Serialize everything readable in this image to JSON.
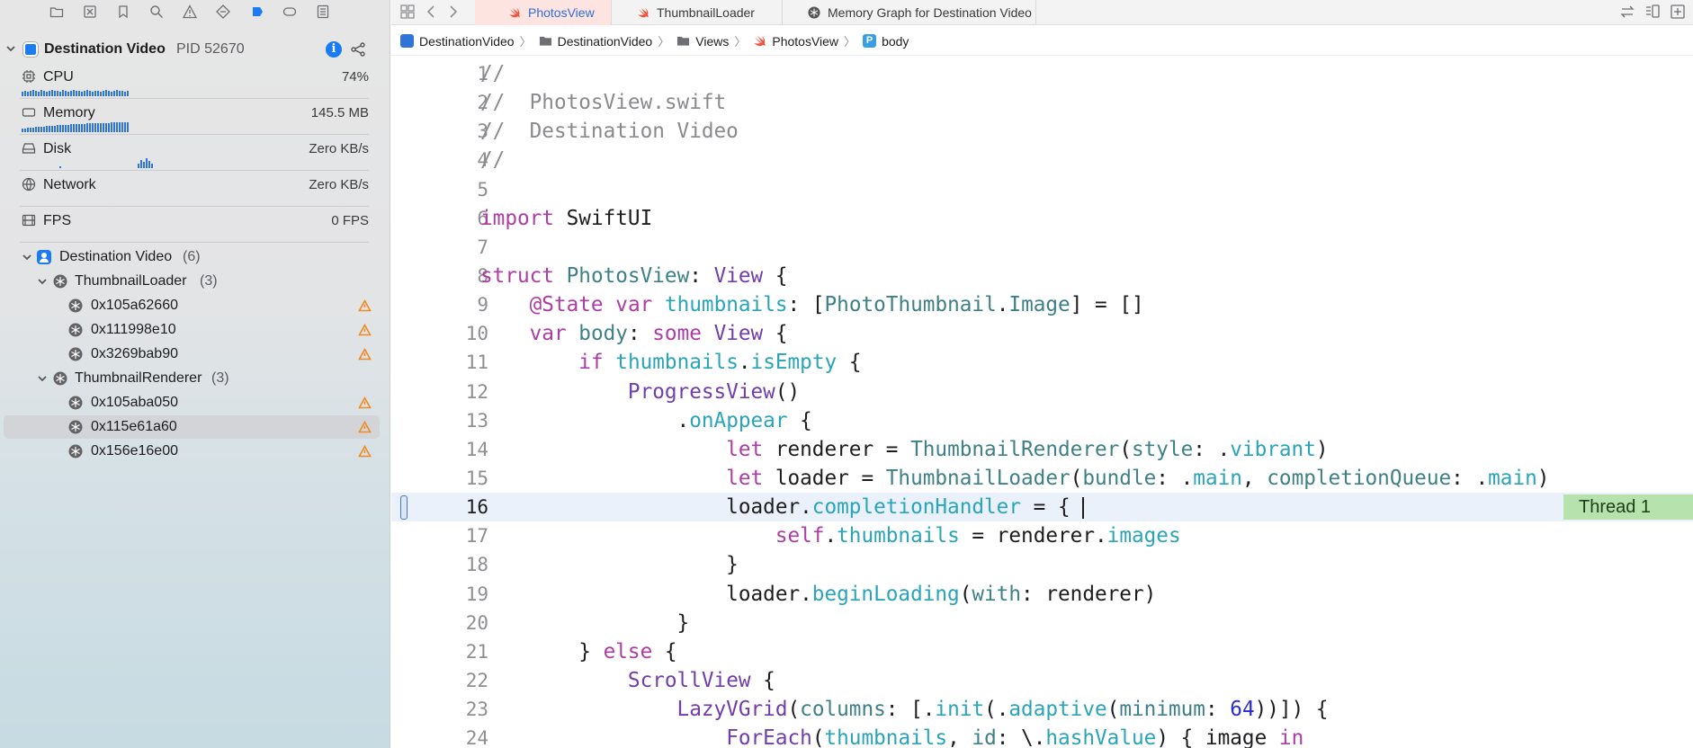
{
  "sidebar": {
    "toolbar_icons": [
      "folder-icon",
      "xmark-square-icon",
      "bookmark-icon",
      "search-icon",
      "warning-icon",
      "diamond-icon",
      "debug-icon",
      "tag-icon",
      "list-icon"
    ],
    "process": {
      "name": "Destination Video",
      "pid": "PID 52670"
    },
    "gauges": [
      {
        "label": "CPU",
        "value": "74%",
        "icon": "cpu-icon"
      },
      {
        "label": "Memory",
        "value": "145.5 MB",
        "icon": "memory-icon"
      },
      {
        "label": "Disk",
        "value": "Zero KB/s",
        "icon": "disk-icon"
      },
      {
        "label": "Network",
        "value": "Zero KB/s",
        "icon": "network-icon"
      },
      {
        "label": "FPS",
        "value": "0 FPS",
        "icon": "fps-icon"
      }
    ],
    "tree": {
      "root": {
        "label": "Destination Video",
        "count": "(6)"
      },
      "groups": [
        {
          "label": "ThumbnailLoader",
          "count": "(3)",
          "items": [
            "0x105a62660",
            "0x111998e10",
            "0x3269bab90"
          ]
        },
        {
          "label": "ThumbnailRenderer",
          "count": "(3)",
          "items": [
            "0x105aba050",
            "0x115e61a60",
            "0x156e16e00"
          ]
        }
      ],
      "selected": "0x115e61a60"
    }
  },
  "tabs": [
    {
      "label": "PhotosView",
      "active": true
    },
    {
      "label": "ThumbnailLoader",
      "active": false
    },
    {
      "label": "Memory Graph for Destination Video",
      "active": false
    }
  ],
  "breadcrumb": [
    "DestinationVideo",
    "DestinationVideo",
    "Views",
    "PhotosView",
    "body"
  ],
  "editor": {
    "current_line": "16",
    "thread_badge": "Thread 1",
    "lines": [
      {
        "n": "1",
        "t": "//"
      },
      {
        "n": "2",
        "t": "//  PhotosView.swift"
      },
      {
        "n": "3",
        "t": "//  Destination Video"
      },
      {
        "n": "4",
        "t": "//"
      },
      {
        "n": "5",
        "t": ""
      },
      {
        "n": "6",
        "t": "import SwiftUI"
      },
      {
        "n": "7",
        "t": ""
      },
      {
        "n": "8",
        "t": "struct PhotosView: View {"
      },
      {
        "n": "9",
        "t": "    @State var thumbnails: [PhotoThumbnail.Image] = []"
      },
      {
        "n": "10",
        "t": "    var body: some View {"
      },
      {
        "n": "11",
        "t": "        if thumbnails.isEmpty {"
      },
      {
        "n": "12",
        "t": "            ProgressView()"
      },
      {
        "n": "13",
        "t": "                .onAppear {"
      },
      {
        "n": "14",
        "t": "                    let renderer = ThumbnailRenderer(style: .vibrant)"
      },
      {
        "n": "15",
        "t": "                    let loader = ThumbnailLoader(bundle: .main, completionQueue: .main)"
      },
      {
        "n": "16",
        "t": "                    loader.completionHandler = { "
      },
      {
        "n": "17",
        "t": "                        self.thumbnails = renderer.images"
      },
      {
        "n": "18",
        "t": "                    }"
      },
      {
        "n": "19",
        "t": "                    loader.beginLoading(with: renderer)"
      },
      {
        "n": "20",
        "t": "                }"
      },
      {
        "n": "21",
        "t": "        } else {"
      },
      {
        "n": "22",
        "t": "            ScrollView {"
      },
      {
        "n": "23",
        "t": "                LazyVGrid(columns: [.init(.adaptive(minimum: 64))]) {"
      },
      {
        "n": "24",
        "t": "                    ForEach(thumbnails, id: \\.hashValue) { image in"
      }
    ]
  }
}
